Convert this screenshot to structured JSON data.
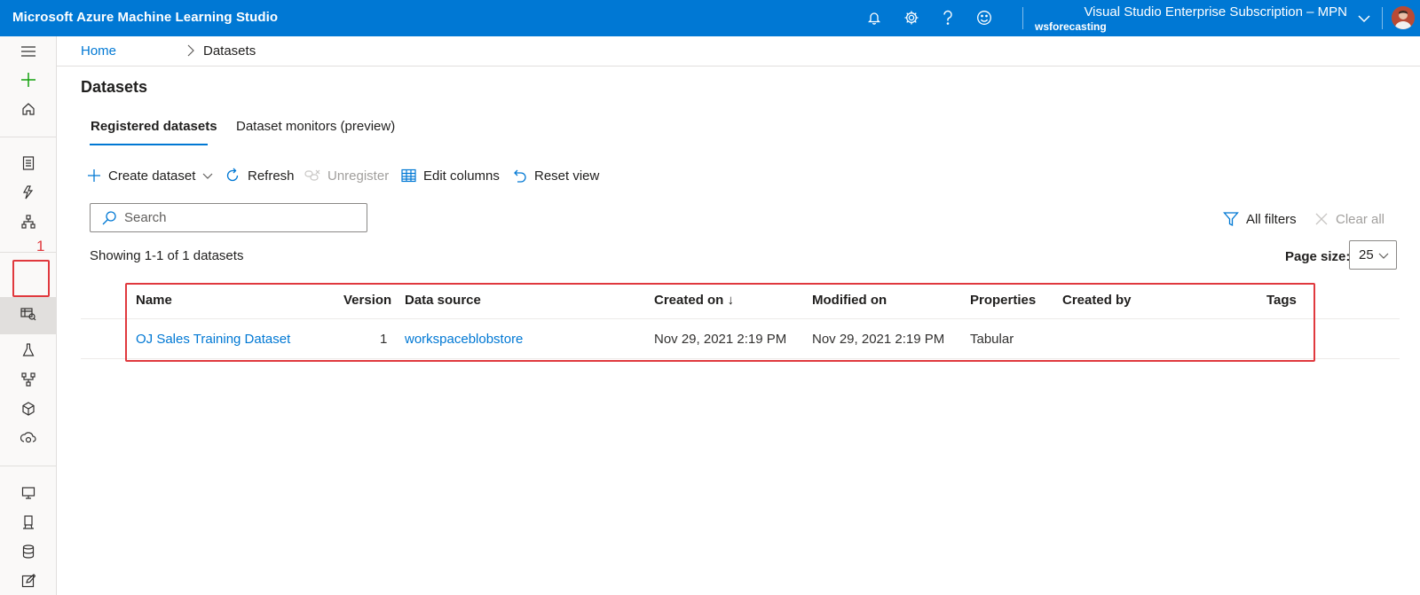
{
  "app": {
    "title": "Microsoft Azure Machine Learning Studio"
  },
  "header": {
    "subscription": "Visual Studio Enterprise Subscription – MPN",
    "workspace": "wsforecasting"
  },
  "breadcrumb": {
    "home": "Home",
    "current": "Datasets"
  },
  "page": {
    "title": "Datasets"
  },
  "tabs": [
    {
      "label": "Registered datasets",
      "active": true
    },
    {
      "label": "Dataset monitors (preview)",
      "active": false
    }
  ],
  "toolbar": {
    "create": "Create dataset",
    "refresh": "Refresh",
    "unregister": "Unregister",
    "edit_columns": "Edit columns",
    "reset_view": "Reset view"
  },
  "search": {
    "placeholder": "Search"
  },
  "filters": {
    "all": "All filters",
    "clear": "Clear all"
  },
  "results": {
    "showing": "Showing 1-1 of 1 datasets"
  },
  "pagination": {
    "label": "Page size:",
    "value": "25"
  },
  "annotation": {
    "label": "1",
    "color": "#e0393e"
  },
  "table": {
    "columns": [
      "Name",
      "Version",
      "Data source",
      "Created on ↓",
      "Modified on",
      "Properties",
      "Created by",
      "Tags"
    ],
    "rows": [
      {
        "name": "OJ Sales Training Dataset",
        "version": "1",
        "data_source": "workspaceblobstore",
        "created_on": "Nov 29, 2021 2:19 PM",
        "modified_on": "Nov 29, 2021 2:19 PM",
        "properties": "Tabular",
        "created_by": "",
        "tags": ""
      }
    ]
  },
  "colors": {
    "brand": "#0078d4",
    "annotation": "#e0393e",
    "rail": "#faf9f8"
  },
  "icons": {
    "top": [
      "bell-icon",
      "gear-icon",
      "help-icon",
      "smiley-icon"
    ],
    "rail": [
      "hamburger-icon",
      "plus-icon",
      "home-icon",
      "notebook-icon",
      "automl-icon",
      "designer-icon",
      "datasets-icon",
      "experiments-icon",
      "pipelines-icon",
      "models-icon",
      "endpoints-icon",
      "compute-icon",
      "environments-icon",
      "datastores-icon",
      "labeling-icon",
      "linked-services-icon"
    ]
  }
}
